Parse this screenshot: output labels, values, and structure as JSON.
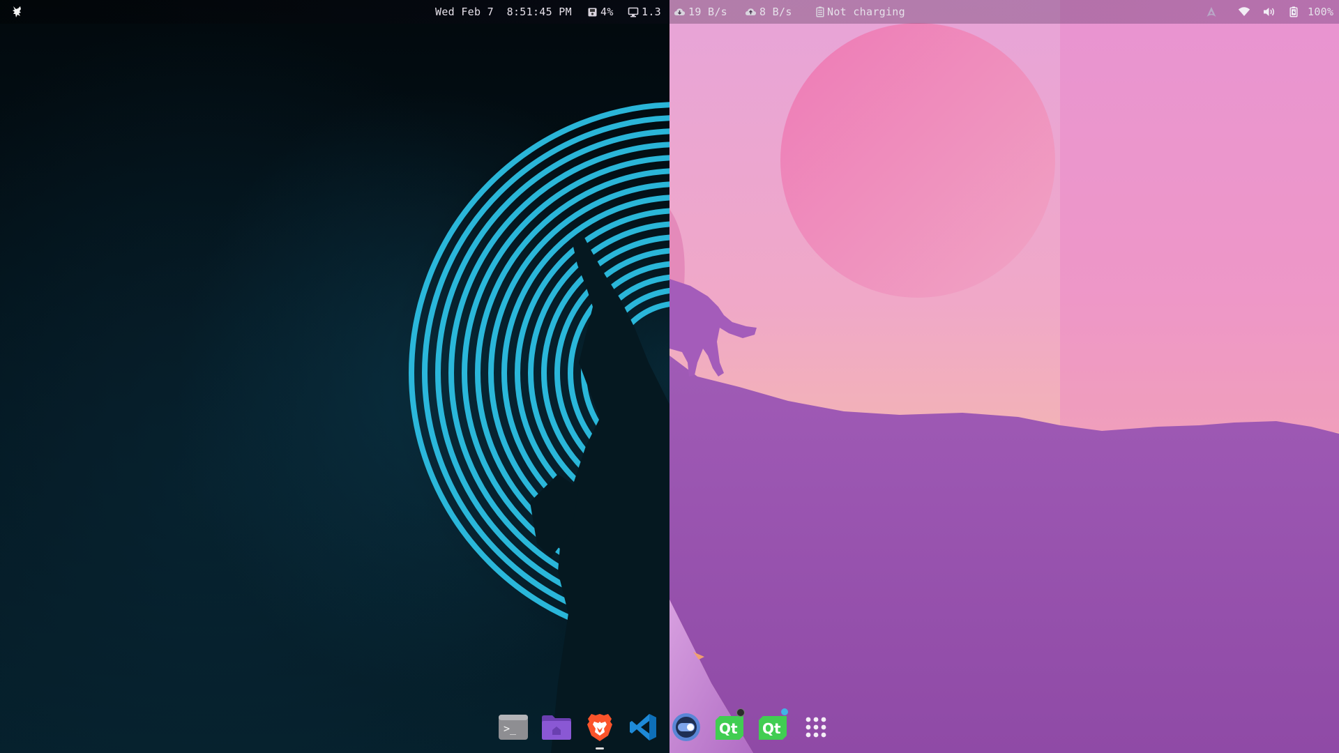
{
  "topbar": {
    "logo_icon": "wolf-logo-icon",
    "datetime": "Wed Feb 7  8:51:45 PM",
    "disk_usage": "4%",
    "cpu_load": "1.3",
    "download_speed": "19 B/s",
    "upload_speed": "8 B/s",
    "power_status": "Not charging",
    "battery_level": "100%",
    "tray_icons": [
      "arch-icon",
      "wifi-icon",
      "volume-icon",
      "battery-icon"
    ]
  },
  "dock": {
    "apps": [
      {
        "name": "Terminal",
        "icon": "terminal-icon",
        "label": ">_",
        "running": false
      },
      {
        "name": "Files",
        "icon": "folder-icon",
        "running": false
      },
      {
        "name": "Brave",
        "icon": "brave-lion-icon",
        "running": true
      },
      {
        "name": "VS Code",
        "icon": "vscode-icon",
        "running": false
      },
      {
        "name": "Toggle",
        "icon": "toggle-icon",
        "running": false
      },
      {
        "name": "Qt",
        "icon": "qt-icon",
        "label": "Qt",
        "badge_color": "#2b2b2b",
        "running": false
      },
      {
        "name": "Qt Designer",
        "icon": "qt-designer-icon",
        "label": "Qt",
        "badge_color": "#41b4e6",
        "running": false
      },
      {
        "name": "App Grid",
        "icon": "app-grid-icon",
        "running": false
      }
    ]
  },
  "colors": {
    "accent_cyan": "#2fc3e8",
    "pink_sun": "#eb78b2",
    "hill_purple": "#9a4fb0",
    "qt_green": "#41cd52"
  }
}
